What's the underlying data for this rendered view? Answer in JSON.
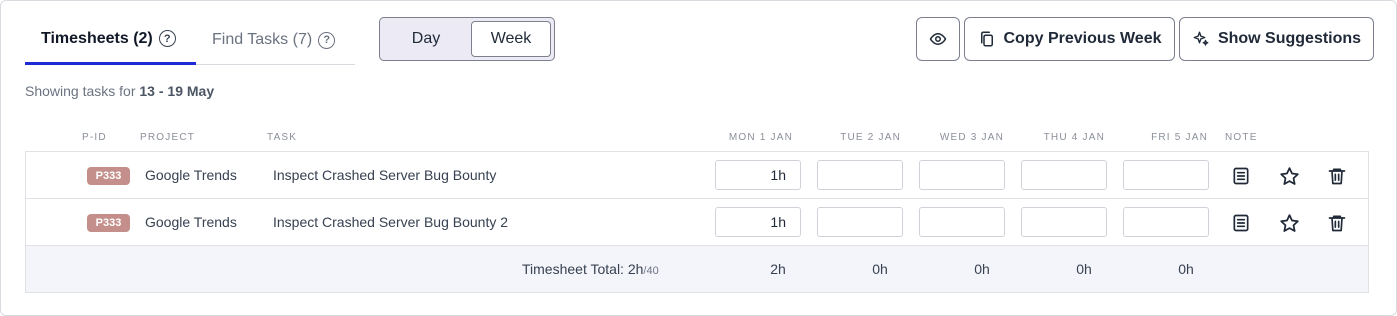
{
  "tabs": {
    "timesheets": "Timesheets (2)",
    "find_tasks": "Find Tasks (7)",
    "help": "?"
  },
  "toggle": {
    "day": "Day",
    "week": "Week",
    "selected": "Week"
  },
  "actions": {
    "view_icon": "eye-icon",
    "copy_label": "Copy Previous Week",
    "copy_icon": "copy-icon",
    "suggest_label": "Show Suggestions",
    "suggest_icon": "sparkle-icon"
  },
  "showing": {
    "prefix": "Showing tasks for",
    "range": "13 - 19 May"
  },
  "columns": {
    "pid": "P-ID",
    "project": "PROJECT",
    "task": "TASK",
    "days": [
      "MON 1 JAN",
      "TUE 2 JAN",
      "WED 3 JAN",
      "THU 4 JAN",
      "FRI 5 JAN"
    ],
    "note": "NOTE"
  },
  "rows": [
    {
      "pid": "P333",
      "project": "Google Trends",
      "task": "Inspect Crashed Server Bug Bounty",
      "hours": [
        "1h",
        "",
        "",
        "",
        ""
      ]
    },
    {
      "pid": "P333",
      "project": "Google Trends",
      "task": "Inspect Crashed Server Bug Bounty 2",
      "hours": [
        "1h",
        "",
        "",
        "",
        ""
      ]
    }
  ],
  "total": {
    "label": "Timesheet Total: 2h",
    "max": "/40",
    "days": [
      "2h",
      "0h",
      "0h",
      "0h",
      "0h"
    ]
  },
  "colors": {
    "accent": "#1d2bd6",
    "pid_badge": "#c48f8b"
  }
}
